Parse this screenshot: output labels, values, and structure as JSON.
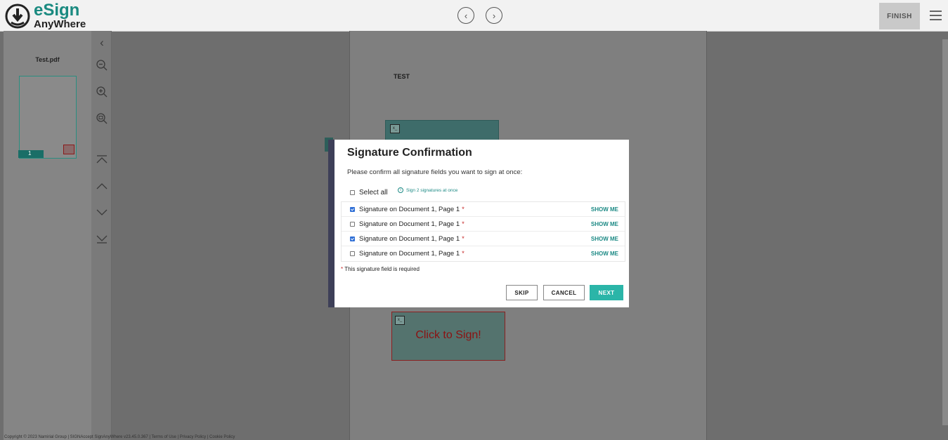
{
  "header": {
    "logo_line1": "eSign",
    "logo_line2": "AnyWhere",
    "finish_label": "FINISH",
    "prev_icon": "chevron-left-circle-icon",
    "next_icon": "chevron-right-circle-icon",
    "menu_icon": "hamburger-menu-icon"
  },
  "sidebar": {
    "file_name": "Test.pdf",
    "page_number": "1"
  },
  "toolbar": {
    "items": [
      "collapse-icon",
      "zoom-out-icon",
      "zoom-in-icon",
      "zoom-fit-icon",
      "first-page-icon",
      "previous-page-icon",
      "next-page-icon",
      "last-page-icon"
    ]
  },
  "document": {
    "text": "TEST",
    "sign_field_label": "Click to Sign!"
  },
  "modal": {
    "title": "Signature Confirmation",
    "description": "Please confirm all signature fields you want to sign at once:",
    "select_all_label": "Select all",
    "sign_at_once": "Sign 2 signatures at once",
    "rows": [
      {
        "label": "Signature on Document 1, Page 1",
        "required": "*",
        "action": "SHOW ME",
        "checked": true
      },
      {
        "label": "Signature on Document 1, Page 1",
        "required": "*",
        "action": "SHOW ME",
        "checked": false
      },
      {
        "label": "Signature on Document 1, Page 1",
        "required": "*",
        "action": "SHOW ME",
        "checked": true
      },
      {
        "label": "Signature on Document 1, Page 1",
        "required": "*",
        "action": "SHOW ME",
        "checked": false
      }
    ],
    "required_note_star": "*",
    "required_note": " This signature field is required",
    "skip_label": "SKIP",
    "cancel_label": "CANCEL",
    "next_label": "NEXT"
  },
  "footer": {
    "text": "Copyright © 2023 Namirial Group | SIGNAccept SignAnyWhere v23.45.0.367 | Terms of Use | Privacy Policy | Cookie Policy"
  },
  "colors": {
    "accent": "#2bb5a8",
    "link": "#1d8a85",
    "required": "#c62828"
  }
}
